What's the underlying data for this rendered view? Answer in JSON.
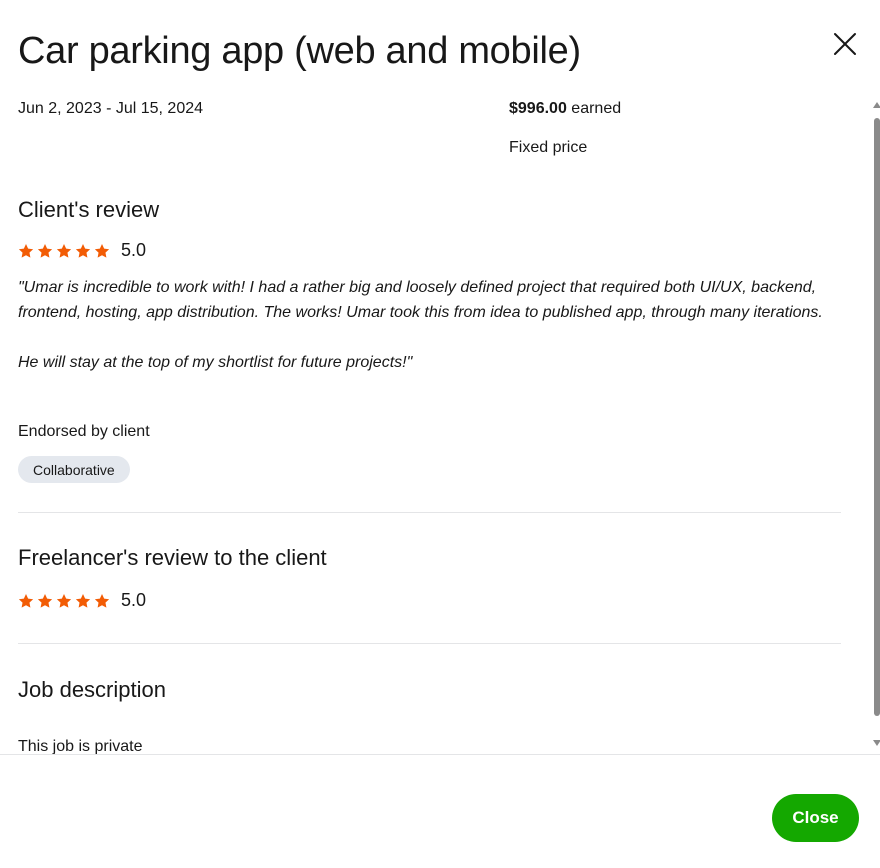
{
  "modal": {
    "title": "Car parking app (web and mobile)",
    "close_icon": "close-x-icon"
  },
  "contract": {
    "date_range": "Jun 2, 2023 - Jul 15, 2024",
    "amount": "$996.00",
    "amount_suffix": " earned",
    "price_type": "Fixed price"
  },
  "client_review": {
    "heading": "Client's review",
    "rating": 5.0,
    "rating_text": "5.0",
    "star_icon": "star-icon",
    "paragraphs": [
      "\"Umar is incredible to work with! I had a rather big and loosely defined project that required both UI/UX, backend, frontend, hosting, app distribution. The works! Umar took this from idea to published app, through many iterations.",
      "He will stay at the top of my shortlist for future projects!\""
    ],
    "endorsed_label": "Endorsed by client",
    "endorsements": [
      "Collaborative"
    ]
  },
  "freelancer_review": {
    "heading": "Freelancer's review to the client",
    "rating": 5.0,
    "rating_text": "5.0"
  },
  "job_description": {
    "heading": "Job description",
    "text": "This job is private"
  },
  "footer": {
    "close_label": "Close"
  },
  "colors": {
    "star": "#f25c05",
    "primary_button": "#14a800",
    "chip_bg": "#e4e8ee",
    "text": "#181818",
    "divider": "#e4e5e7"
  }
}
